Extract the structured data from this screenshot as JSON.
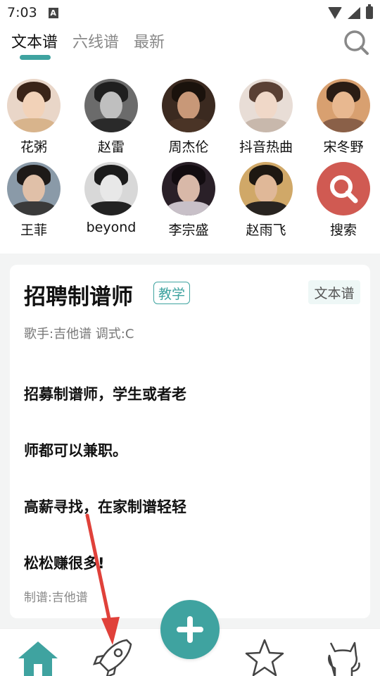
{
  "status_bar": {
    "time": "7:03",
    "notification_letter": "A"
  },
  "tabs": [
    {
      "label": "文本谱",
      "active": true
    },
    {
      "label": "六线谱",
      "active": false
    },
    {
      "label": "最新",
      "active": false
    }
  ],
  "artists": [
    {
      "name": "花粥"
    },
    {
      "name": "赵雷"
    },
    {
      "name": "周杰伦"
    },
    {
      "name": "抖音热曲"
    },
    {
      "name": "宋冬野"
    },
    {
      "name": "王菲"
    },
    {
      "name": "beyond"
    },
    {
      "name": "李宗盛"
    },
    {
      "name": "赵雨飞"
    },
    {
      "name": "搜索"
    }
  ],
  "card": {
    "title": "招聘制谱师",
    "badge": "教学",
    "type": "文本谱",
    "meta": "歌手:吉他谱  调式:C",
    "lyrics": [
      "招募制谱师，学生或者老",
      "师都可以兼职。",
      "高薪寻找，在家制谱轻轻",
      "松松赚很多!"
    ],
    "author": "制谱:吉他谱"
  },
  "bottom_nav": {
    "items": [
      "home-icon",
      "rocket-icon",
      "add-icon",
      "star-icon",
      "cat-icon"
    ]
  },
  "colors": {
    "accent": "#3fa3a0",
    "search_avatar": "#d05a52",
    "arrow": "#e0413a"
  }
}
